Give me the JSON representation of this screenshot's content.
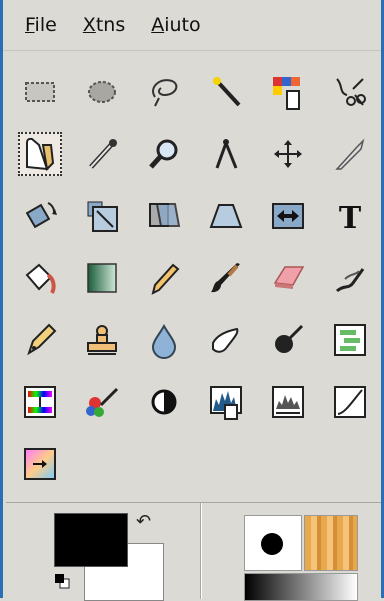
{
  "menu": {
    "file": "File",
    "xtns": "Xtns",
    "aiuto": "Aiuto"
  },
  "tools": [
    "rect-select",
    "ellipse-select",
    "free-select",
    "fuzzy-select",
    "color-select",
    "scissors-select",
    "paths",
    "color-picker",
    "zoom",
    "measure",
    "move",
    "crop",
    "rotate",
    "scale",
    "shear",
    "perspective",
    "flip",
    "text",
    "bucket-fill",
    "blend",
    "pencil",
    "paintbrush",
    "eraser",
    "airbrush",
    "ink",
    "clone",
    "convolve",
    "smudge",
    "dodge-burn",
    "color-balance",
    "hue-saturation",
    "colorize",
    "threshold",
    "levels",
    "curves",
    "posterize",
    "gradient-map"
  ],
  "active_tool": "paths",
  "colors": {
    "foreground": "#000000",
    "background": "#ffffff"
  }
}
